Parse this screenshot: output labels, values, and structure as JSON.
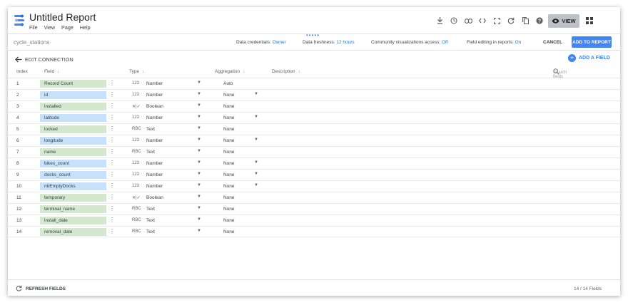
{
  "app": {
    "title": "Untitled Report",
    "menu": [
      "File",
      "View",
      "Page",
      "Help"
    ],
    "toolbar_icons": [
      "download-icon",
      "history-icon",
      "link-icon",
      "embed-code-icon",
      "fullscreen-icon",
      "refresh-icon",
      "copy-icon",
      "help-icon"
    ],
    "view_label": "VIEW"
  },
  "subbar": {
    "datasource": "cycle_stations",
    "credentials_label": "Data credentials:",
    "credentials_value": "Owner",
    "freshness_label": "Data freshness:",
    "freshness_value": "12 hours",
    "community_label": "Community visualizations access:",
    "community_value": "Off",
    "editing_label": "Field editing in reports:",
    "editing_value": "On",
    "cancel_label": "CANCEL",
    "add_to_report_label": "ADD TO REPORT"
  },
  "edit": {
    "label": "EDIT CONNECTION",
    "add_field_label": "ADD A FIELD"
  },
  "table": {
    "headers": {
      "index": "Index",
      "field": "Field",
      "type": "Type",
      "aggregation": "Aggregation",
      "description": "Description"
    },
    "search_placeholder": "Search fields",
    "rows": [
      {
        "index": "1",
        "field": "Record Count",
        "kind": "met",
        "type_code": "123",
        "type": "Number",
        "agg": "Auto",
        "agg_dropdown": false
      },
      {
        "index": "2",
        "field": "id",
        "kind": "dim",
        "type_code": "123",
        "type": "Number",
        "agg": "None",
        "agg_dropdown": true
      },
      {
        "index": "3",
        "field": "installed",
        "kind": "met",
        "type_code": "✕|✓",
        "type": "Boolean",
        "agg": "None",
        "agg_dropdown": false
      },
      {
        "index": "4",
        "field": "latitude",
        "kind": "dim",
        "type_code": "123",
        "type": "Number",
        "agg": "None",
        "agg_dropdown": true
      },
      {
        "index": "5",
        "field": "locked",
        "kind": "met",
        "type_code": "RBC",
        "type": "Text",
        "agg": "None",
        "agg_dropdown": false
      },
      {
        "index": "6",
        "field": "longitude",
        "kind": "dim",
        "type_code": "123",
        "type": "Number",
        "agg": "None",
        "agg_dropdown": true
      },
      {
        "index": "7",
        "field": "name",
        "kind": "met",
        "type_code": "RBC",
        "type": "Text",
        "agg": "None",
        "agg_dropdown": false
      },
      {
        "index": "8",
        "field": "bikes_count",
        "kind": "dim",
        "type_code": "123",
        "type": "Number",
        "agg": "None",
        "agg_dropdown": true
      },
      {
        "index": "9",
        "field": "docks_count",
        "kind": "dim",
        "type_code": "123",
        "type": "Number",
        "agg": "None",
        "agg_dropdown": true
      },
      {
        "index": "10",
        "field": "nbEmptyDocks",
        "kind": "dim",
        "type_code": "123",
        "type": "Number",
        "agg": "None",
        "agg_dropdown": true
      },
      {
        "index": "11",
        "field": "temporary",
        "kind": "met",
        "type_code": "✕|✓",
        "type": "Boolean",
        "agg": "None",
        "agg_dropdown": false
      },
      {
        "index": "12",
        "field": "terminal_name",
        "kind": "met",
        "type_code": "RBC",
        "type": "Text",
        "agg": "None",
        "agg_dropdown": false
      },
      {
        "index": "13",
        "field": "install_date",
        "kind": "met",
        "type_code": "RBC",
        "type": "Text",
        "agg": "None",
        "agg_dropdown": false
      },
      {
        "index": "14",
        "field": "removal_date",
        "kind": "met",
        "type_code": "RBC",
        "type": "Text",
        "agg": "None",
        "agg_dropdown": false
      }
    ]
  },
  "footer": {
    "refresh_label": "REFRESH FIELDS",
    "count": "14 / 14 Fields"
  },
  "colors": {
    "accent": "#4285f4",
    "dimension_chip": "#c6e1fa",
    "metric_chip": "#d3e8cf"
  }
}
